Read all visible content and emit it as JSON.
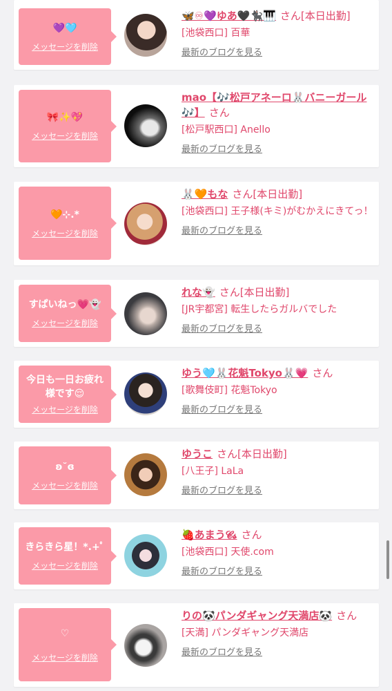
{
  "colors": {
    "accent": "#e0476b",
    "bubble": "#fb9aa8",
    "background": "#f2f2f4"
  },
  "delete_label": "メッセージを削除",
  "blog_label": "最新のブログを見る",
  "san_label": "さん",
  "cards": [
    {
      "message": "💜🩵",
      "name": "🦋♾💜ゆあ🖤🐈‍⬛🎹",
      "status": "[本日出勤]",
      "shop": "[池袋西口] 百華"
    },
    {
      "message": "🎀✨💖",
      "name": "mao【🎶松戸アネーロ🐰バニーガール🎶】",
      "status": "",
      "shop": "[松戸駅西口] Anello"
    },
    {
      "message": "🧡⊹.*",
      "name": "🐰🧡もな",
      "status": "[本日出勤]",
      "shop": "[池袋西口] 王子様(キミ)がむかえにきてっ！"
    },
    {
      "message": "すぱいねっ💗👻",
      "name": "れな👻",
      "status": "[本日出勤]",
      "shop": "[JR宇都宮] 転生したらガルバでした"
    },
    {
      "message": "今日も一日お疲れ様です😌",
      "name": "ゆう🩵🐰花魁Tokyo🐰💗",
      "status": "",
      "shop": "[歌舞伎町] 花魁Tokyo"
    },
    {
      "message": "ʚ˘ɞ",
      "name": "ゆうこ",
      "status": "[本日出勤]",
      "shop": "[八王子] LaLa"
    },
    {
      "message": "きらきら星！*.+ﾟ",
      "name": "🍓あまう𝓒𝓼",
      "status": "",
      "shop": "[池袋西口] 天使.com"
    },
    {
      "message": "♡",
      "name": "りの🐼パンダギャング天満店🐼",
      "status": "",
      "shop": "[天満] パンダギャング天満店"
    }
  ]
}
